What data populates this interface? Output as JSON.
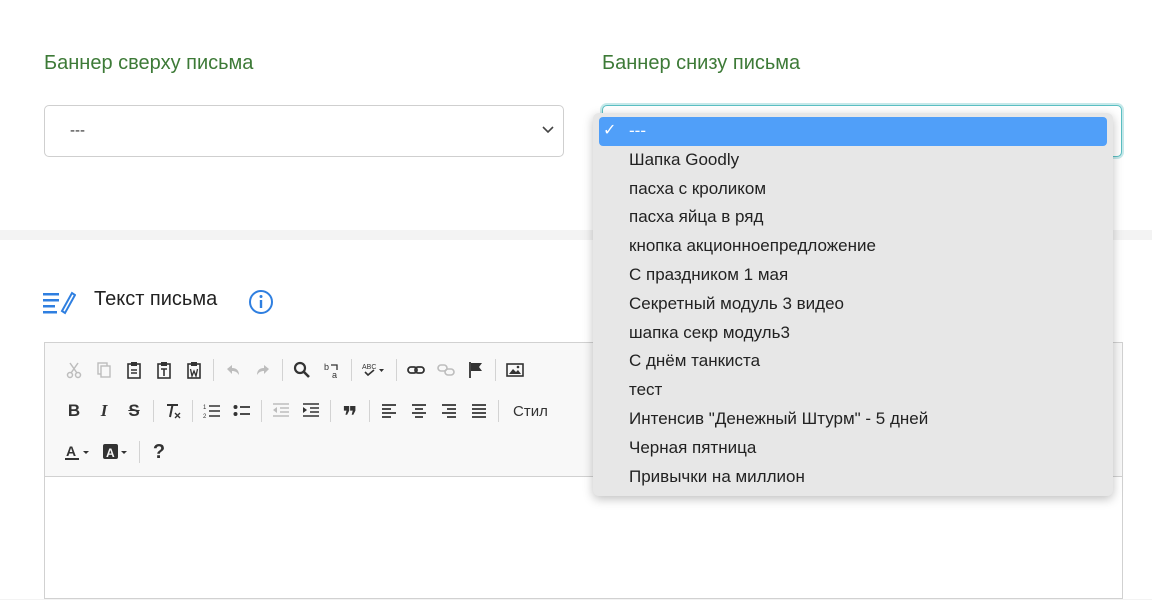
{
  "banners": {
    "top_label": "Баннер сверху письма",
    "bottom_label": "Баннер снизу письма",
    "top_select_value": "---"
  },
  "dropdown": {
    "check": "✓",
    "options": [
      "---",
      "Шапка Goodly",
      "пасха с кроликом",
      "пасха яйца в ряд",
      "кнопка акционноепредложение",
      "С праздником 1 мая",
      "Секретный модуль 3 видео",
      "шапка секр модуль3",
      "С днём танкиста",
      "тест",
      "Интенсив \"Денежный Штурм\" - 5 дней",
      "Черная пятница",
      "Привычки на миллион"
    ],
    "selected_index": 0
  },
  "editor": {
    "title": "Текст письма",
    "styles_label": "Стил",
    "icons": {
      "cut": "cut-icon",
      "copy": "copy-icon",
      "paste": "paste-icon",
      "undo": "undo-icon",
      "redo": "redo-icon",
      "find": "search-icon",
      "link": "link-icon",
      "image": "image-icon",
      "bold": "B",
      "italic": "I",
      "strike": "S",
      "help": "?",
      "blockquote": "❞"
    }
  },
  "colors": {
    "label_green": "#3d7a37",
    "focus": "#5bbfc3",
    "selected_option": "#509ff9",
    "icon_blue": "#2f7fe0"
  }
}
